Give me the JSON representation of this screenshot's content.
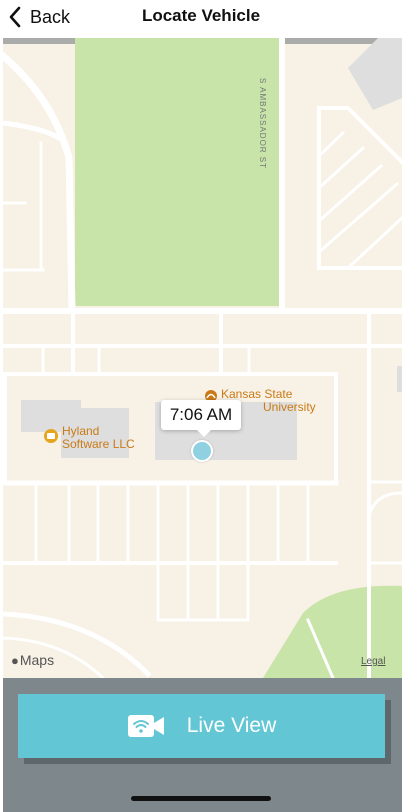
{
  "nav": {
    "back_label": "Back",
    "title": "Locate Vehicle"
  },
  "map": {
    "street_label": "S AMBASSADOR ST",
    "pois": [
      {
        "name": "Kansas State University",
        "line1": "Kansas State",
        "line2": "University",
        "icon": "university-icon"
      },
      {
        "name": "Hyland Software LLC",
        "line1": "Hyland",
        "line2": "Software LLC",
        "icon": "business-icon"
      }
    ],
    "vehicle_time": "7:06 AM",
    "attribution": "Maps",
    "legal_label": "Legal",
    "colors": {
      "land": "#f7f1e6",
      "park": "#c8e4a8",
      "building": "#dedede",
      "road": "#ffffff",
      "poi": "#c97a16",
      "vehicle": "#8fd1e0"
    }
  },
  "action": {
    "live_view_label": "Live View",
    "icon": "video-wifi-icon",
    "color": "#62c6d4"
  }
}
